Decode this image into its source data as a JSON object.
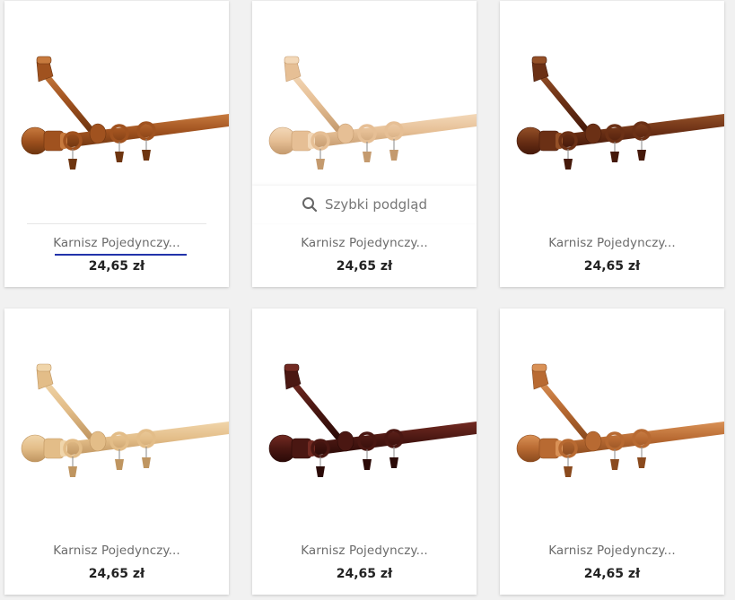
{
  "products": [
    {
      "title": "Karnisz Pojedynczy...",
      "price": "24,65 zł",
      "color": "#a0521f",
      "light": "#c77a3e",
      "dark": "#6e3510"
    },
    {
      "title": "Karnisz Pojedynczy...",
      "price": "24,65 zł",
      "color": "#e6bf95",
      "light": "#f3d8b8",
      "dark": "#c49a6e",
      "quick_view": "Szybki podgląd"
    },
    {
      "title": "Karnisz Pojedynczy...",
      "price": "24,65 zł",
      "color": "#6b3015",
      "light": "#945027",
      "dark": "#45190a"
    },
    {
      "title": "Karnisz Pojedynczy...",
      "price": "24,65 zł",
      "color": "#e3bd88",
      "light": "#f0d5aa",
      "dark": "#bf9560"
    },
    {
      "title": "Karnisz Pojedynczy...",
      "price": "24,65 zł",
      "color": "#4a1712",
      "light": "#722a22",
      "dark": "#2b0a07"
    },
    {
      "title": "Karnisz Pojedynczy...",
      "price": "24,65 zł",
      "color": "#b86a32",
      "light": "#d99156",
      "dark": "#8a4a1e"
    }
  ],
  "hovered_index": 0,
  "colors": {
    "background": "#f1f1f1",
    "card": "#ffffff",
    "title": "#6b6b6b",
    "price": "#222222",
    "link_underline": "#2233aa"
  }
}
